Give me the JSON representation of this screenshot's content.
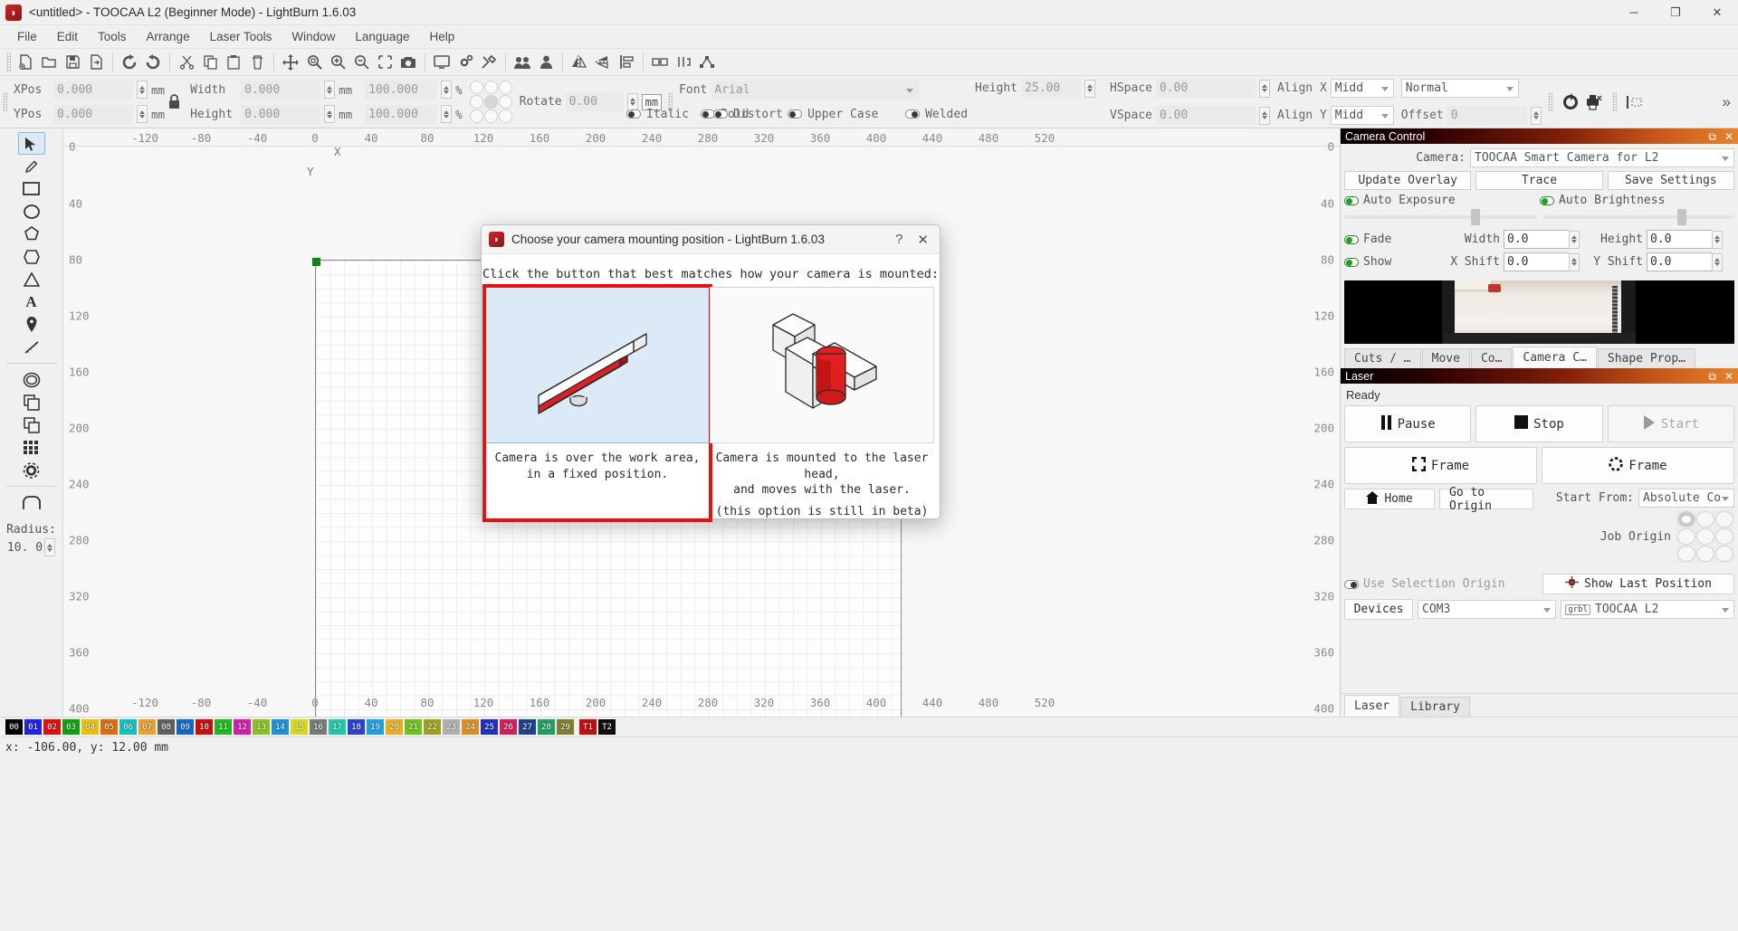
{
  "window": {
    "title": "<untitled> - TOOCAA L2 (Beginner Mode) - LightBurn 1.6.03",
    "logo_glyph": "◗",
    "minimize": "─",
    "maximize": "❐",
    "close": "✕"
  },
  "menubar": {
    "items": [
      "File",
      "Edit",
      "Tools",
      "Arrange",
      "Laser Tools",
      "Window",
      "Language",
      "Help"
    ]
  },
  "toolbar": {
    "icons": [
      "new-file-icon",
      "open-file-icon",
      "save-file-icon",
      "save-as-icon",
      "undo-icon",
      "redo-icon",
      "cut-icon",
      "copy-icon",
      "paste-icon",
      "delete-icon",
      "move-icon",
      "zoom-fit-icon",
      "zoom-in-icon",
      "zoom-out-icon",
      "zoom-selection-icon",
      "camera-icon",
      "frame-preview-icon",
      "settings-icon",
      "device-settings-icon",
      "group-icon",
      "ungroup-icon",
      "mirror-horizontal-icon",
      "mirror-vertical-icon",
      "align-icon",
      "weld-icon",
      "boolean-icon",
      "node-edit-icon"
    ]
  },
  "properties": {
    "xpos": {
      "label": "XPos",
      "value": "0.000",
      "unit": "mm"
    },
    "ypos": {
      "label": "YPos",
      "value": "0.000",
      "unit": "mm"
    },
    "width": {
      "label": "Width",
      "value": "0.000",
      "unit": "mm"
    },
    "height": {
      "label": "Height",
      "value": "0.000",
      "unit": "mm"
    },
    "width_pct": {
      "value": "100.000",
      "unit": "%"
    },
    "height_pct": {
      "value": "100.000",
      "unit": "%"
    },
    "lock_icon": "lock-icon",
    "rotate": {
      "label": "Rotate",
      "value": "0.00",
      "unit": "mm"
    },
    "font": {
      "label": "Font",
      "value": "Arial"
    },
    "text_height": {
      "label": "Height",
      "value": "25.00"
    },
    "bold": {
      "label": "Bold",
      "on": false
    },
    "italic": {
      "label": "Italic",
      "on": false
    },
    "upper_case": {
      "label": "Upper Case",
      "on": false
    },
    "distort": {
      "label": "Distort",
      "on": false
    },
    "welded": {
      "label": "Welded",
      "on": false
    },
    "hspace": {
      "label": "HSpace",
      "value": "0.00"
    },
    "vspace": {
      "label": "VSpace",
      "value": "0.00"
    },
    "align_x": {
      "label": "Align X",
      "value": "Midd"
    },
    "align_y": {
      "label": "Align Y",
      "value": "Midd"
    },
    "normal": {
      "value": "Normal"
    },
    "offset": {
      "label": "Offset",
      "value": "0"
    },
    "overflow_glyph": "»"
  },
  "tools": {
    "items": [
      {
        "name": "select-tool",
        "glyph": "➤",
        "selected": true
      },
      {
        "name": "pen-tool",
        "glyph": "✎",
        "selected": false
      },
      {
        "name": "rectangle-tool",
        "glyph": "▭",
        "selected": false
      },
      {
        "name": "ellipse-tool",
        "glyph": "◯",
        "selected": false
      },
      {
        "name": "polygon-tool",
        "glyph": "⬠",
        "selected": false
      },
      {
        "name": "closed-shape-tool",
        "glyph": "⬟",
        "selected": false
      },
      {
        "name": "triangle-tool",
        "glyph": "△",
        "selected": false
      },
      {
        "name": "text-tool",
        "glyph": "A",
        "selected": false
      },
      {
        "name": "pin-tool",
        "glyph": "⚑",
        "selected": false
      },
      {
        "name": "measure-tool",
        "glyph": "╱",
        "selected": false
      },
      {
        "name": "offset-shape-tool",
        "glyph": "⬭",
        "selected": false
      },
      {
        "name": "copy-along-path-tool",
        "glyph": "⧉",
        "selected": false
      },
      {
        "name": "array-copy-tool",
        "glyph": "▦",
        "selected": false
      },
      {
        "name": "grid-array-tool",
        "glyph": "░",
        "selected": false
      },
      {
        "name": "weld-shapes-tool",
        "glyph": "⚙",
        "selected": false
      },
      {
        "name": "radius-tool",
        "glyph": "⌒",
        "selected": false
      }
    ],
    "radius": {
      "label": "Radius:",
      "value": "10. 0"
    }
  },
  "canvas": {
    "top_ruler": [
      "-120",
      "-80",
      "-40",
      "0",
      "40",
      "80",
      "120",
      "160",
      "200",
      "240",
      "280",
      "320",
      "360",
      "400",
      "440",
      "480",
      "520"
    ],
    "bottom_ruler": [
      "-120",
      "-80",
      "-40",
      "0",
      "40",
      "80",
      "120",
      "160",
      "200",
      "240",
      "280",
      "320",
      "360",
      "400",
      "440",
      "480",
      "520"
    ],
    "left_ruler": [
      "0",
      "40",
      "80",
      "120",
      "160",
      "200",
      "240",
      "280",
      "320",
      "360",
      "400"
    ],
    "right_ruler": [
      "0",
      "40",
      "80",
      "120",
      "160",
      "200",
      "240",
      "280",
      "320",
      "360",
      "400"
    ],
    "axis_x_label": "X",
    "axis_y_label": "Y"
  },
  "camera_panel": {
    "title": "Camera Control",
    "undock_glyph": "⧉",
    "close_glyph": "✕",
    "camera_label": "Camera:",
    "camera_value": "TOOCAA Smart Camera for L2",
    "buttons": [
      "Update Overlay",
      "Trace",
      "Save Settings"
    ],
    "auto_exposure": {
      "label": "Auto Exposure",
      "on": true
    },
    "auto_brightness": {
      "label": "Auto Brightness",
      "on": true
    },
    "fade": {
      "label": "Fade",
      "on": true
    },
    "show": {
      "label": "Show",
      "on": true
    },
    "width": {
      "label": "Width",
      "value": "0.0"
    },
    "height": {
      "label": "Height",
      "value": "0.0"
    },
    "x_shift": {
      "label": "X Shift",
      "value": "0.0"
    },
    "y_shift": {
      "label": "Y Shift",
      "value": "0.0"
    }
  },
  "dock_tabs": [
    {
      "label": "Cuts / …",
      "active": false
    },
    {
      "label": "Move",
      "active": false
    },
    {
      "label": "Co…",
      "active": false
    },
    {
      "label": "Camera C…",
      "active": true
    },
    {
      "label": "Shape Prop…",
      "active": false
    }
  ],
  "laser_panel": {
    "title": "Laser",
    "undock_glyph": "⧉",
    "close_glyph": "✕",
    "status": "Ready",
    "pause": {
      "label": "Pause",
      "icon": "pause-icon"
    },
    "stop": {
      "label": "Stop",
      "icon": "stop-icon"
    },
    "start": {
      "label": "Start",
      "icon": "play-icon",
      "disabled": true
    },
    "frame_rect": {
      "label": "Frame",
      "icon": "frame-rect-icon"
    },
    "frame_round": {
      "label": "Frame",
      "icon": "frame-round-icon"
    },
    "home": {
      "label": "Home",
      "icon": "home-icon"
    },
    "go_to_origin": {
      "label": "Go to Origin"
    },
    "start_from": {
      "label": "Start From:",
      "value": "Absolute Co"
    },
    "job_origin": {
      "label": "Job Origin",
      "selected_index": 0
    },
    "use_selection_origin": {
      "label": "Use Selection Origin",
      "on": false
    },
    "show_last_position": {
      "label": "Show Last Position",
      "icon": "crosshair-icon"
    },
    "devices": {
      "label": "Devices",
      "port": "COM3",
      "device": "TOOCAA  L2",
      "device_prefix": "grbl"
    },
    "bottom_tabs": [
      {
        "label": "Laser",
        "active": true
      },
      {
        "label": "Library",
        "active": false
      }
    ]
  },
  "dialog": {
    "logo_glyph": "◗",
    "title": "Choose your camera mounting position - LightBurn 1.6.03",
    "help_glyph": "?",
    "close_glyph": "✕",
    "prompt": "Click the button that best matches how your camera is mounted:",
    "options": [
      {
        "name": "fixed-position-option",
        "caption_line1": "Camera is over the work area,",
        "caption_line2": "in a fixed position.",
        "selected": true,
        "icon": "gantry-mounted-camera-icon"
      },
      {
        "name": "laser-head-option",
        "caption_line1": "Camera is mounted to the laser head,",
        "caption_line2": "and moves with the laser.",
        "selected": false,
        "icon": "laser-head-camera-icon"
      }
    ],
    "beta_note": "(this option is still in beta)"
  },
  "palette": {
    "swatches": [
      {
        "label": "00",
        "color": "#000000"
      },
      {
        "label": "01",
        "color": "#2222e8"
      },
      {
        "label": "02",
        "color": "#e01010"
      },
      {
        "label": "03",
        "color": "#12a012"
      },
      {
        "label": "04",
        "color": "#e8c010"
      },
      {
        "label": "05",
        "color": "#e06a10"
      },
      {
        "label": "06",
        "color": "#12c0c0"
      },
      {
        "label": "07",
        "color": "#e8a030"
      },
      {
        "label": "08",
        "color": "#606060"
      },
      {
        "label": "09",
        "color": "#1068c8"
      },
      {
        "label": "10",
        "color": "#c81010"
      },
      {
        "label": "11",
        "color": "#20b820"
      },
      {
        "label": "12",
        "color": "#d020a8"
      },
      {
        "label": "13",
        "color": "#8ac020"
      },
      {
        "label": "14",
        "color": "#2090d8"
      },
      {
        "label": "15",
        "color": "#d8d820"
      },
      {
        "label": "16",
        "color": "#7a7a7a"
      },
      {
        "label": "17",
        "color": "#20c8a8"
      },
      {
        "label": "18",
        "color": "#3040d0"
      },
      {
        "label": "19",
        "color": "#20a0e0"
      },
      {
        "label": "20",
        "color": "#e8b020"
      },
      {
        "label": "21",
        "color": "#70c020"
      },
      {
        "label": "22",
        "color": "#a0a020"
      },
      {
        "label": "23",
        "color": "#b0b0b0"
      },
      {
        "label": "24",
        "color": "#d89020"
      },
      {
        "label": "25",
        "color": "#2030c0"
      },
      {
        "label": "26",
        "color": "#d02060"
      },
      {
        "label": "27",
        "color": "#204090"
      },
      {
        "label": "28",
        "color": "#20a060"
      },
      {
        "label": "29",
        "color": "#808030"
      },
      {
        "label": "T1",
        "color": "#c01010"
      },
      {
        "label": "T2",
        "color": "#101010"
      }
    ]
  },
  "statusbar": {
    "coords": "x: -106.00, y: 12.00 mm"
  }
}
